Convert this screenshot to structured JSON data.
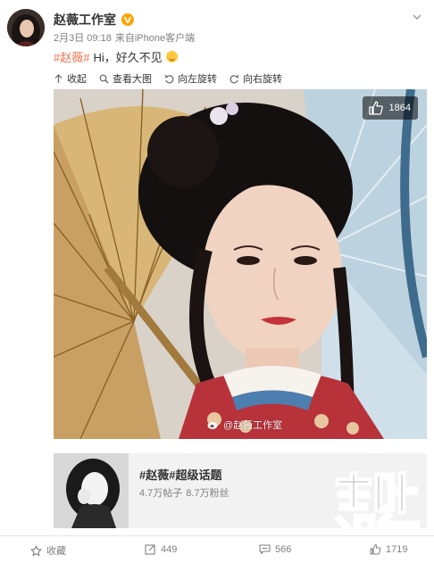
{
  "post": {
    "author_name": "赵薇工作室",
    "date": "2月3日 09:18",
    "source_prefix": "来自",
    "source": "iPhone客户端",
    "hashtag": "#赵薇#",
    "text": "Hi，好久不见"
  },
  "toolbar": {
    "collapse": "收起",
    "view_large": "查看大图",
    "rotate_left": "向左旋转",
    "rotate_right": "向右旋转"
  },
  "photo": {
    "like_count": "1864",
    "watermark": "@赵薇工作室"
  },
  "topic": {
    "title": "#赵薇#超级话题",
    "posts": "4.7万帖子",
    "fans": "8.7万粉丝"
  },
  "footer": {
    "favorite": "收藏",
    "repost_count": "449",
    "comment_count": "566",
    "like_count": "1719"
  },
  "colors": {
    "hashtag": "#eb7350",
    "verified": "#ffa200",
    "brand": "#ffffff"
  },
  "icons": {
    "verified": "verified-v-icon",
    "collapse": "collapse-arrow-icon",
    "view_large": "magnifier-icon",
    "rotate_left": "rotate-left-icon",
    "rotate_right": "rotate-right-icon",
    "like": "thumbs-up-icon",
    "favorite": "star-icon",
    "repost": "repost-icon",
    "comment": "comment-icon"
  }
}
